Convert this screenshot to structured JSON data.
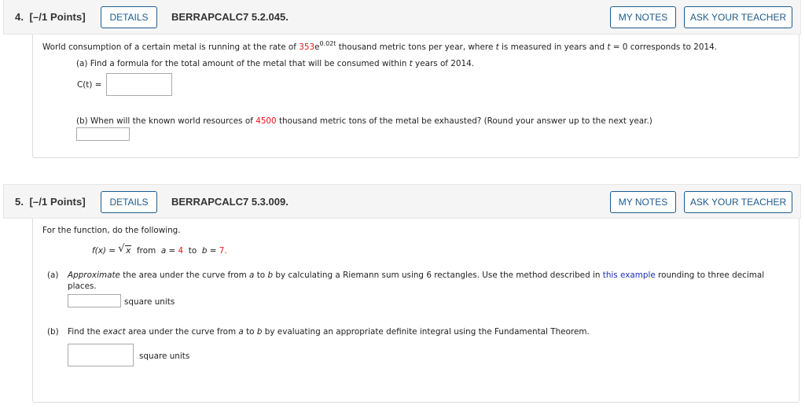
{
  "questions": [
    {
      "number": "4.",
      "points": "[–/1 Points]",
      "details_label": "DETAILS",
      "code": "BERRAPCALC7 5.2.045.",
      "my_notes_label": "MY NOTES",
      "ask_teacher_label": "ASK YOUR TEACHER",
      "intro": {
        "before": "World consumption of a certain metal is running at the rate of ",
        "coef": "353",
        "base": "e",
        "exponent": "0.02t",
        "after_1": " thousand metric tons per year, where ",
        "var_t": "t",
        "after_2": " is measured in years and ",
        "var_t2": "t",
        "after_3": " = 0 corresponds to 2014."
      },
      "part_a": {
        "prefix": "(a) Find a formula for the total amount of the metal that will be consumed within ",
        "var_t": "t",
        "suffix": " years of 2014.",
        "answer_label": "C(t) =",
        "answer_value": ""
      },
      "part_b": {
        "prefix": "(b) When will the known world resources of ",
        "amount": "4500",
        "suffix": " thousand metric tons of the metal be exhausted? (Round your answer up to the next year.)",
        "answer_value": ""
      }
    },
    {
      "number": "5.",
      "points": "[–/1 Points]",
      "details_label": "DETAILS",
      "code": "BERRAPCALC7 5.3.009.",
      "my_notes_label": "MY NOTES",
      "ask_teacher_label": "ASK YOUR TEACHER",
      "intro": "For the function, do the following.",
      "function": {
        "lhs": "f(x) =",
        "radicand": "x",
        "from": "from",
        "a_var": "a",
        "eq": "=",
        "a_val": "4",
        "to": "to",
        "b_var": "b",
        "b_val": "7",
        "period": "."
      },
      "part_a": {
        "label": "(a)",
        "emph": "Approximate",
        "text_1": " the area under the curve from ",
        "var_a": "a",
        "text_2": " to ",
        "var_b": "b",
        "text_3": " by calculating a Riemann sum using 6 rectangles. Use the method described in ",
        "link": "this example",
        "text_4": " rounding to three decimal",
        "line2": "places.",
        "answer_value": "",
        "units": "square units"
      },
      "part_b": {
        "label": "(b)",
        "text_1": "Find the ",
        "emph": "exact",
        "text_2": " area under the curve from ",
        "var_a": "a",
        "text_3": " to ",
        "var_b": "b",
        "text_4": " by evaluating an appropriate definite integral using the Fundamental Theorem.",
        "answer_value": "",
        "units": "square units"
      }
    }
  ]
}
